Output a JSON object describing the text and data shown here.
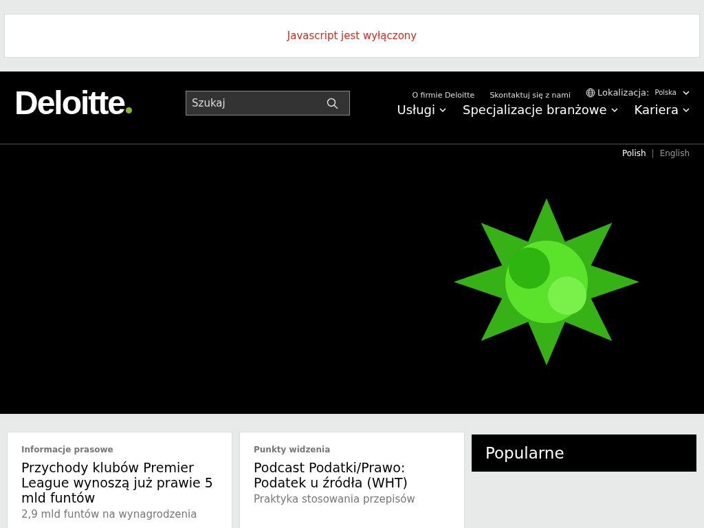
{
  "notice": {
    "text": "Javascript jest wyłączony"
  },
  "header": {
    "logo": "Deloitte",
    "search": {
      "placeholder": "Szukaj"
    },
    "utility_links": [
      "O firmie Deloitte",
      "Skontaktuj się z nami"
    ],
    "location": {
      "label": "Lokalizacja:",
      "value": "Polska"
    },
    "main_nav": [
      "Usługi",
      "Specjalizacje branżowe",
      "Kariera"
    ]
  },
  "language_separator": "|",
  "languages": [
    {
      "label": "Polish",
      "selected": true
    },
    {
      "label": "English",
      "selected": false
    }
  ],
  "cards": [
    {
      "category": "Informacje prasowe",
      "title": "Przychody klubów Premier League wynoszą już prawie 5 mld funtów",
      "summary": "2,9 mld funtów na wynagrodzenia"
    },
    {
      "category": "Punkty widzenia",
      "title": "Podcast Podatki/Prawo: Podatek u źródła (WHT)",
      "summary": "Praktyka stosowania przepisów"
    }
  ],
  "popular": {
    "title": "Popularne"
  }
}
